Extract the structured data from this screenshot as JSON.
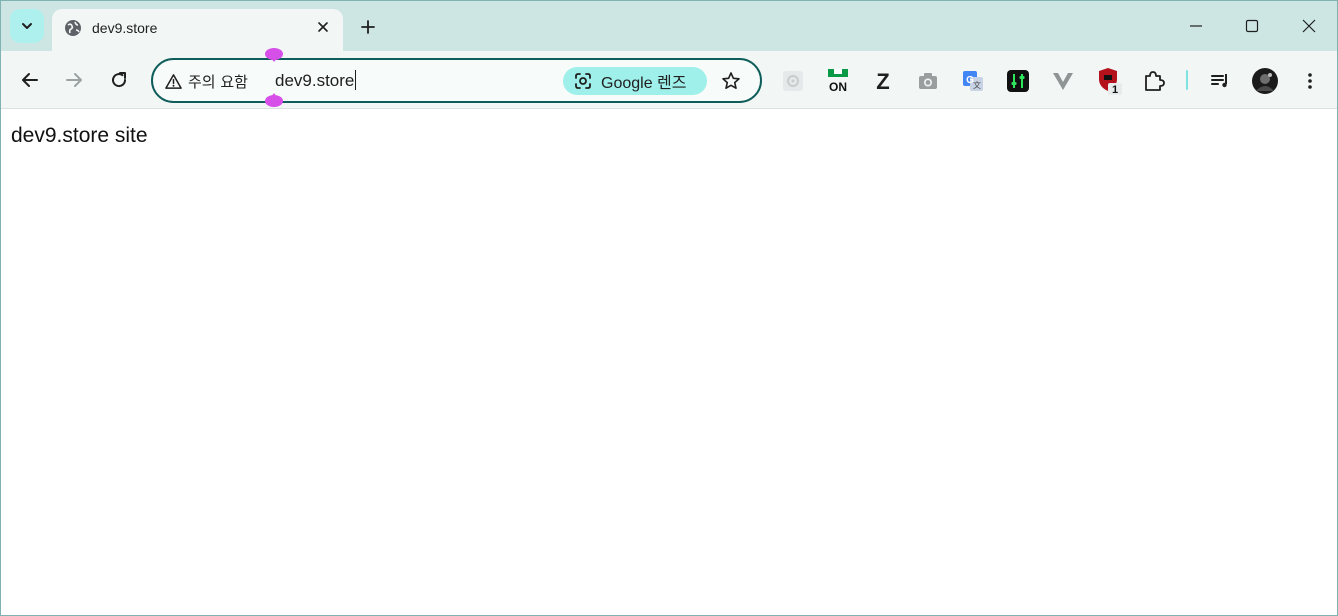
{
  "tab": {
    "title": "dev9.store",
    "favicon": "globe-icon",
    "close_icon": "close-icon"
  },
  "tabstrip": {
    "tab_search_icon": "chevron-down-icon",
    "new_tab_icon": "plus-icon"
  },
  "window_controls": {
    "minimize_icon": "minimize-icon",
    "maximize_icon": "maximize-icon",
    "close_icon": "close-icon"
  },
  "nav": {
    "back_icon": "arrow-left-icon",
    "forward_icon": "arrow-right-icon",
    "reload_icon": "reload-icon"
  },
  "omnibox": {
    "security_label": "주의 요함",
    "url": "dev9.store",
    "lens_label": "Google 렌즈",
    "bookmark_icon": "star-icon"
  },
  "extensions": [
    {
      "name": "settings-ext-icon"
    },
    {
      "name": "on-ext-icon",
      "label": "ON"
    },
    {
      "name": "z-ext-icon",
      "label": "Z"
    },
    {
      "name": "camera-ext-icon"
    },
    {
      "name": "translate-ext-icon"
    },
    {
      "name": "equalizer-ext-icon"
    },
    {
      "name": "v-ext-icon"
    },
    {
      "name": "shield-ext-icon",
      "badge": "1"
    },
    {
      "name": "puzzle-icon"
    },
    {
      "name": "media-queue-icon"
    },
    {
      "name": "avatar"
    },
    {
      "name": "kebab-menu-icon"
    }
  ],
  "page": {
    "body_text": "dev9.store site"
  },
  "colors": {
    "tabstrip_bg": "#cde6e3",
    "toolbar_bg": "#f2f7f6",
    "omnibox_border": "#0f5d5a",
    "lens_bg": "#9ff0ea",
    "selection_handle": "#d64fe8"
  }
}
